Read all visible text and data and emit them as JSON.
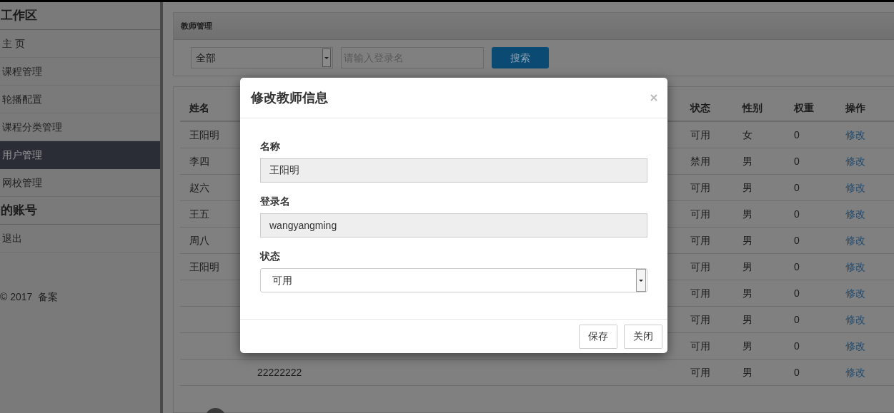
{
  "sidebar": {
    "sections": [
      {
        "title": "工作区",
        "items": [
          {
            "label": "主 页",
            "selected": false
          },
          {
            "label": "课程管理",
            "selected": false
          },
          {
            "label": "轮播配置",
            "selected": false
          },
          {
            "label": "课程分类管理",
            "selected": false
          },
          {
            "label": "用户管理",
            "selected": true
          },
          {
            "label": "网校管理",
            "selected": false
          }
        ]
      },
      {
        "title": "的账号",
        "items": [
          {
            "label": "退出",
            "selected": false
          }
        ]
      }
    ],
    "footer": "© 2017  备案"
  },
  "panel": {
    "title": "教师管理",
    "filter": {
      "value": "全部"
    },
    "search": {
      "placeholder": "请输入登录名"
    },
    "search_button": "搜索"
  },
  "table": {
    "columns": [
      "姓名",
      "状态",
      "性别",
      "权重",
      "操作"
    ],
    "rows": [
      {
        "name": "王阳明",
        "status": "可用",
        "gender": "女",
        "weight": "0",
        "action": "修改"
      },
      {
        "name": "李四",
        "status": "禁用",
        "gender": "男",
        "weight": "0",
        "action": "修改"
      },
      {
        "name": "赵六",
        "status": "可用",
        "gender": "男",
        "weight": "0",
        "action": "修改"
      },
      {
        "name": "王五",
        "status": "可用",
        "gender": "男",
        "weight": "0",
        "action": "修改"
      },
      {
        "name": "周八",
        "status": "可用",
        "gender": "男",
        "weight": "0",
        "action": "修改"
      },
      {
        "name": "王阳明",
        "status": "可用",
        "gender": "男",
        "weight": "0",
        "action": "修改"
      },
      {
        "status": "可用",
        "gender": "男",
        "weight": "0",
        "action": "修改"
      },
      {
        "status": "可用",
        "gender": "男",
        "weight": "0",
        "action": "修改"
      },
      {
        "status": "可用",
        "gender": "男",
        "weight": "0",
        "action": "修改"
      },
      {
        "column_2": "22222222",
        "status": "可用",
        "gender": "男",
        "weight": "0",
        "action": "修改"
      }
    ]
  },
  "modal": {
    "title": "修改教师信息",
    "fields": [
      {
        "kind": "text",
        "label": "名称",
        "value": "王阳明"
      },
      {
        "kind": "text",
        "label": "登录名",
        "value": "wangyangming"
      },
      {
        "kind": "select",
        "label": "状态",
        "value": "可用"
      }
    ],
    "buttons": [
      "保存",
      "关闭"
    ]
  }
}
